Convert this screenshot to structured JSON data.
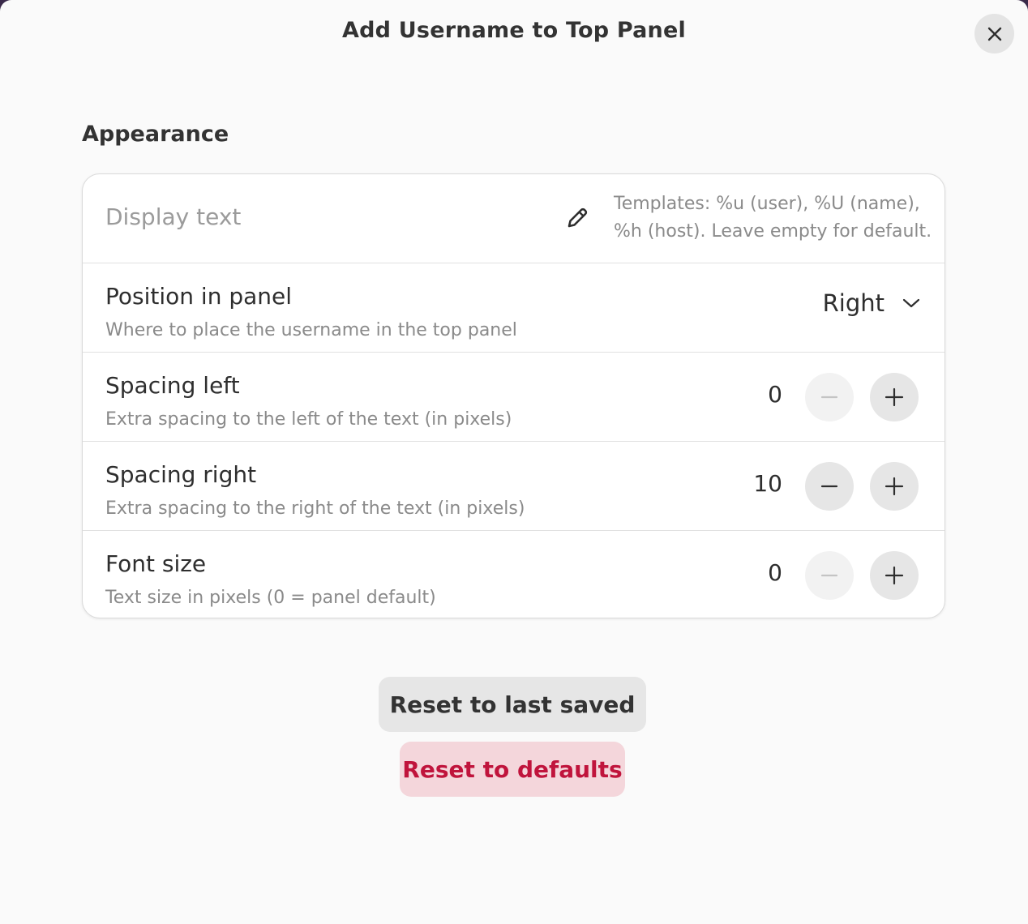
{
  "window": {
    "title": "Add Username to Top Panel",
    "close_icon": "close-icon"
  },
  "appearance": {
    "section_title": "Appearance",
    "display_text": {
      "placeholder": "Display text",
      "value": "",
      "edit_icon": "pencil-icon",
      "hint_line1": "Templates: %u (user), %U (name),",
      "hint_line2": "%h (host). Leave empty for default."
    },
    "position": {
      "title": "Position in panel",
      "subtitle": "Where to place the username in the top panel",
      "value": "Right",
      "icon": "chevron-down-icon"
    },
    "spacing_left": {
      "title": "Spacing left",
      "subtitle": "Extra spacing to the left of the text (in pixels)",
      "value": "0"
    },
    "spacing_right": {
      "title": "Spacing right",
      "subtitle": "Extra spacing to the right of the text (in pixels)",
      "value": "10"
    },
    "font_size": {
      "title": "Font size",
      "subtitle": "Text size in pixels (0 = panel default)",
      "value": "0"
    }
  },
  "actions": {
    "reset_saved_label": "Reset to last saved",
    "reset_defaults_label": "Reset to defaults"
  },
  "colors": {
    "destructive_text": "#c0143c",
    "destructive_bg": "#f4d6db",
    "window_bg": "#fafafa"
  }
}
